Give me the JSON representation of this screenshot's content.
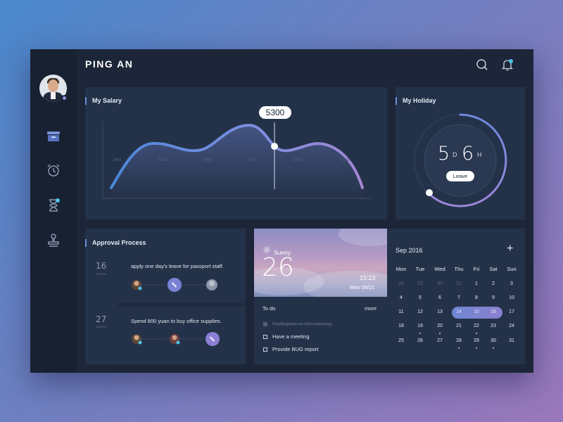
{
  "app": {
    "brand": "PING AN"
  },
  "colors": {
    "accent": "#6c8fdf",
    "accent_purple": "#9a86d8",
    "card": "#243249",
    "panel": "#1c2638",
    "notification": "#4fc3e8"
  },
  "sidebar": {
    "icons": [
      "user-avatar",
      "archive-icon",
      "alarm-clock-icon",
      "hourglass-icon",
      "stamp-icon"
    ]
  },
  "header": {
    "icons": [
      "search-icon",
      "bell-icon"
    ]
  },
  "salary": {
    "title": "My Salary",
    "tooltip_value": "5300",
    "months": [
      "Jan.",
      "Mar.",
      "May",
      "July",
      "Sept.",
      "Nov."
    ]
  },
  "holiday": {
    "title": "My Holiday",
    "days": "5",
    "day_unit": "D",
    "hours": "6",
    "hour_unit": "H",
    "button_label": "Leave"
  },
  "approval": {
    "title": "Approval Process",
    "items": [
      {
        "day": "16",
        "year": "2016.9",
        "text": "apply one day's leave for passport staff."
      },
      {
        "day": "27",
        "year": "2016.9",
        "text": "Spend 800 yuan to buy office supplies."
      }
    ]
  },
  "weather": {
    "condition": "Sunny",
    "temperature": "26",
    "degree_symbol": "°",
    "time": "15:23",
    "date": "Mon 09/21"
  },
  "todo": {
    "title": "To do",
    "more_label": "more",
    "items": [
      {
        "text": "Participate in iOS training",
        "done": true
      },
      {
        "text": "Have a meeting",
        "done": false
      },
      {
        "text": "Provide BUG report",
        "done": false
      }
    ]
  },
  "calendar": {
    "month_label": "Sep  2016",
    "add_label": "+",
    "weekdays": [
      "Mon",
      "Tue",
      "Wed",
      "Thu",
      "Fri",
      "Sat",
      "Sun"
    ],
    "weeks": [
      [
        "28",
        "29",
        "30",
        "31",
        "1",
        "2",
        "3"
      ],
      [
        "4",
        "5",
        "6",
        "7",
        "8",
        "9",
        "10"
      ],
      [
        "11",
        "12",
        "13",
        "14",
        "15",
        "16",
        "17"
      ],
      [
        "18",
        "19",
        "20",
        "21",
        "22",
        "23",
        "24"
      ],
      [
        "25",
        "26",
        "27",
        "28",
        "29",
        "30",
        "31"
      ]
    ],
    "muted_days": [
      "28",
      "29",
      "30",
      "31"
    ],
    "selected_range": [
      "14",
      "15",
      "16"
    ],
    "event_days": [
      "19",
      "20",
      "22",
      "28",
      "29",
      "30"
    ]
  }
}
